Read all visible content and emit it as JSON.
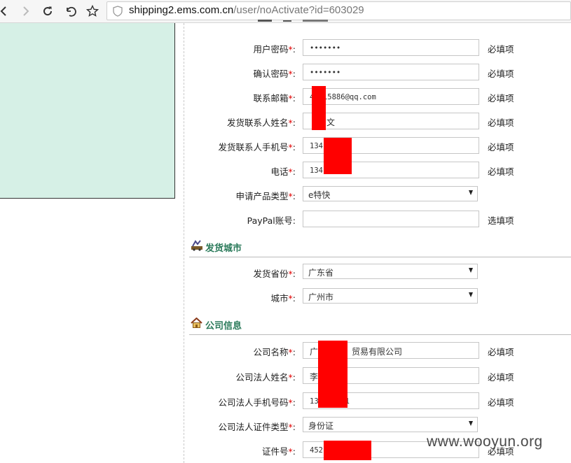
{
  "browser": {
    "url_host": "shipping2.ems.com.cn",
    "url_path": "/user/noActivate?id=603029"
  },
  "form": {
    "top_rows": [
      {
        "label": "用户密码",
        "value": "•••••••",
        "note": "必填项"
      },
      {
        "label": "确认密码",
        "value": "•••••••",
        "note": "必填项"
      },
      {
        "label": "联系邮箱",
        "value": "4  15886@qq.com",
        "note": "必填项"
      },
      {
        "label": "发货联系人姓名",
        "value": "  文",
        "note": "必填项"
      },
      {
        "label": "发货联系人手机号",
        "value": "134    81",
        "note": "必填项"
      },
      {
        "label": "电话",
        "value": "134    81",
        "note": "必填项"
      }
    ],
    "product_type": {
      "label": "申请产品类型",
      "selected": "e特快"
    },
    "paypal": {
      "label": "PayPal账号",
      "value": "",
      "note": "选填项"
    },
    "required_mark": "*",
    "colon": ":"
  },
  "section_city": {
    "title": "发货城市",
    "province": {
      "label": "发货省份",
      "selected": "广东省"
    },
    "city": {
      "label": "城市",
      "selected": "广州市"
    }
  },
  "section_company": {
    "title": "公司信息",
    "rows": [
      {
        "label": "公司名称",
        "value": "广    贸易有限公司",
        "note": "必填项"
      },
      {
        "label": "公司法人姓名",
        "value": "李",
        "note": "必填项"
      },
      {
        "label": "公司法人手机号码",
        "value": "13     81",
        "note": "必填项"
      }
    ],
    "id_type": {
      "label": "公司法人证件类型",
      "selected": "身份证"
    },
    "id_number": {
      "label": "证件号",
      "value": "452       035",
      "note": "必填项"
    }
  },
  "watermark": "www.wooyun.org",
  "colors": {
    "accent_section": "#2a7a5a",
    "required": "#e00000",
    "redaction": "#ff0000",
    "panel": "#d6f0e6"
  }
}
